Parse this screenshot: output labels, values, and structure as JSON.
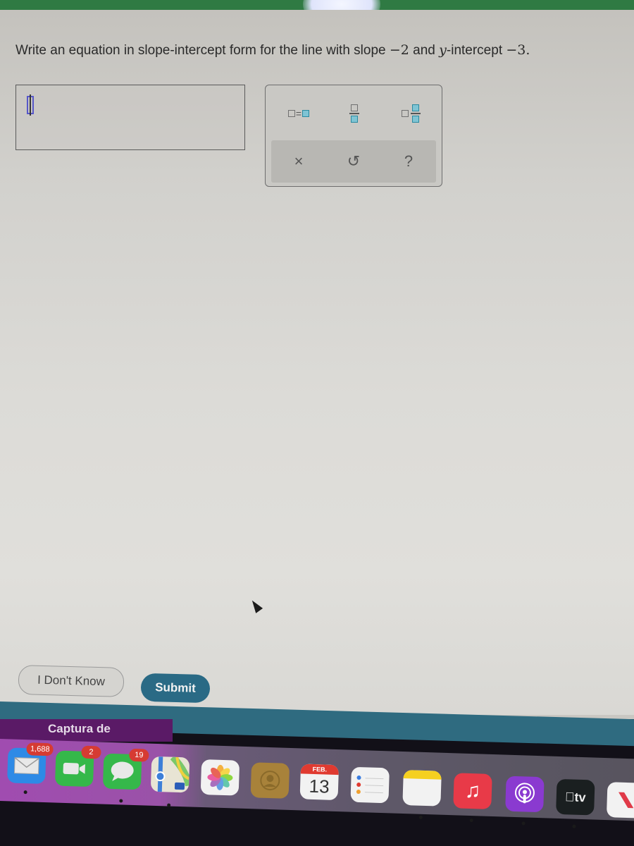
{
  "question": {
    "prefix": "Write an equation in slope-intercept form for the line with slope ",
    "slope": "−2",
    "middle": " and ",
    "var": "y",
    "suffix": "-intercept ",
    "intercept": "−3."
  },
  "answer": {
    "value": ""
  },
  "palette": {
    "templates": [
      {
        "name": "equation-template",
        "label": "□=□"
      },
      {
        "name": "fraction-template",
        "label": "□/□"
      },
      {
        "name": "mixed-number-template",
        "label": "□ □/□"
      }
    ],
    "controls": [
      {
        "name": "clear",
        "glyph": "×"
      },
      {
        "name": "undo",
        "glyph": "↺"
      },
      {
        "name": "help",
        "glyph": "?"
      }
    ]
  },
  "buttons": {
    "dont_know": "I Don't Know",
    "submit": "Submit"
  },
  "captura": "Captura de",
  "dock": {
    "mail": {
      "badge": "1,688"
    },
    "facetime": {
      "badge": "2"
    },
    "messages": {
      "badge": "19"
    },
    "calendar": {
      "month": "FEB.",
      "day": "13"
    },
    "tv": {
      "label": "tv"
    }
  },
  "colors": {
    "submit": "#2a6a85",
    "topbar": "#2f7a43",
    "template_accent": "#7fc4d4"
  }
}
